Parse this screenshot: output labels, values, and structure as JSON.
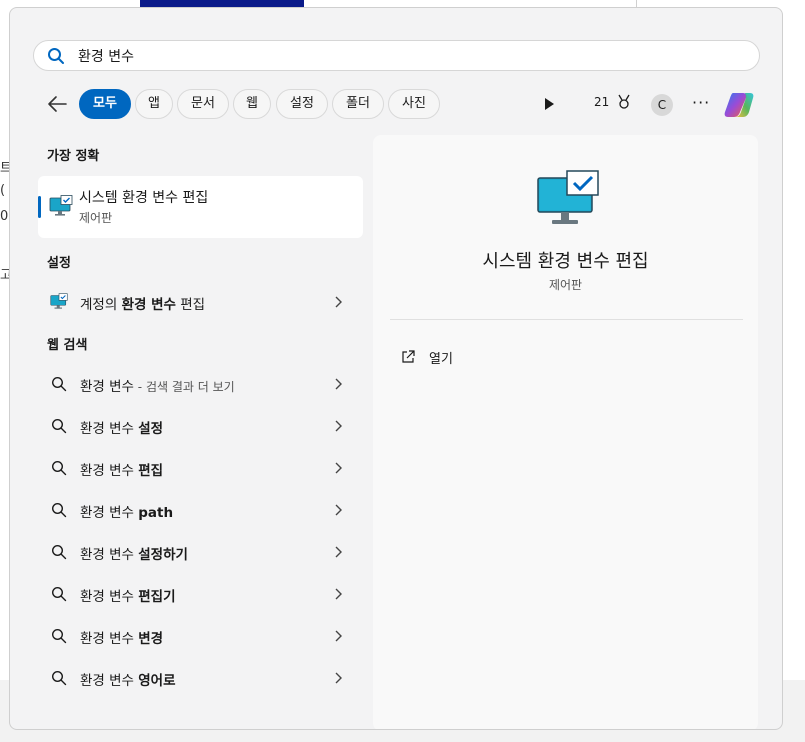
{
  "search": {
    "value": "환경 변수",
    "icon": "search-icon"
  },
  "filters": [
    {
      "label": "모두",
      "active": true
    },
    {
      "label": "앱"
    },
    {
      "label": "문서"
    },
    {
      "label": "웹"
    },
    {
      "label": "설정"
    },
    {
      "label": "폴더"
    },
    {
      "label": "사진"
    }
  ],
  "toolbar": {
    "points": "21",
    "avatar": "C",
    "more": "···"
  },
  "best_match": {
    "header": "가장 정확",
    "title": "시스템 환경 변수 편집",
    "subtitle": "제어판"
  },
  "settings": {
    "header": "설정",
    "items": [
      {
        "prefix": "계정의 ",
        "bold": "환경 변수",
        "suffix": " 편집"
      }
    ]
  },
  "web": {
    "header": "웹 검색",
    "items": [
      {
        "prefix": "환경 변수",
        "bold": "",
        "sub": " - 검색 결과 더 보기"
      },
      {
        "prefix": "환경 변수 ",
        "bold": "설정",
        "sub": ""
      },
      {
        "prefix": "환경 변수 ",
        "bold": "편집",
        "sub": ""
      },
      {
        "prefix": "환경 변수 ",
        "bold": "path",
        "sub": ""
      },
      {
        "prefix": "환경 변수 ",
        "bold": "설정하기",
        "sub": ""
      },
      {
        "prefix": "환경 변수 ",
        "bold": "편집기",
        "sub": ""
      },
      {
        "prefix": "환경 변수 ",
        "bold": "변경",
        "sub": ""
      },
      {
        "prefix": "환경 변수 ",
        "bold": "영어로",
        "sub": ""
      }
    ]
  },
  "detail": {
    "title": "시스템 환경 변수 편집",
    "subtitle": "제어판",
    "actions": [
      {
        "label": "열기"
      }
    ]
  },
  "background_text": [
    "트",
    "(",
    "0",
    "고"
  ],
  "colors": {
    "accent": "#0067c0",
    "panel": "#f3f3f4"
  }
}
